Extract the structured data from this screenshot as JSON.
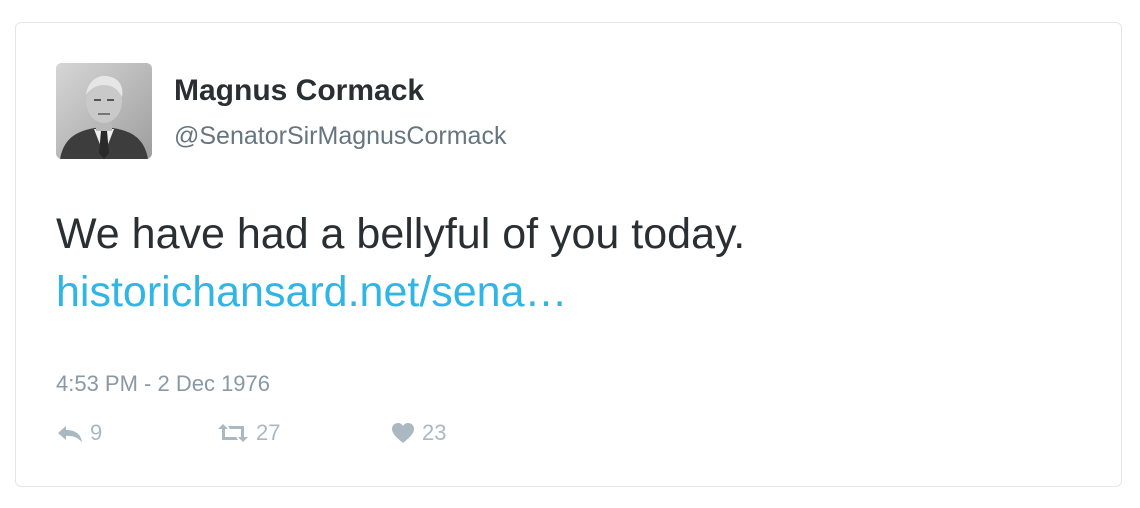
{
  "tweet": {
    "author": {
      "name": "Magnus Cormack",
      "handle": "@SenatorSirMagnusCormack",
      "avatar_icon": "portrait-photo"
    },
    "text_line1": "We have had a bellyful of you today.",
    "link_text": "historichansard.net/sena…",
    "timestamp": "4:53 PM - 2 Dec 1976",
    "actions": {
      "reply": {
        "icon": "reply-icon",
        "count": "9"
      },
      "retweet": {
        "icon": "retweet-icon",
        "count": "27"
      },
      "like": {
        "icon": "heart-icon",
        "count": "23"
      }
    }
  },
  "colors": {
    "text": "#292f33",
    "handle": "#66757f",
    "link": "#2fb5e6",
    "meta": "#8899a6",
    "action": "#aab8c2",
    "border": "#e1e8ed"
  }
}
